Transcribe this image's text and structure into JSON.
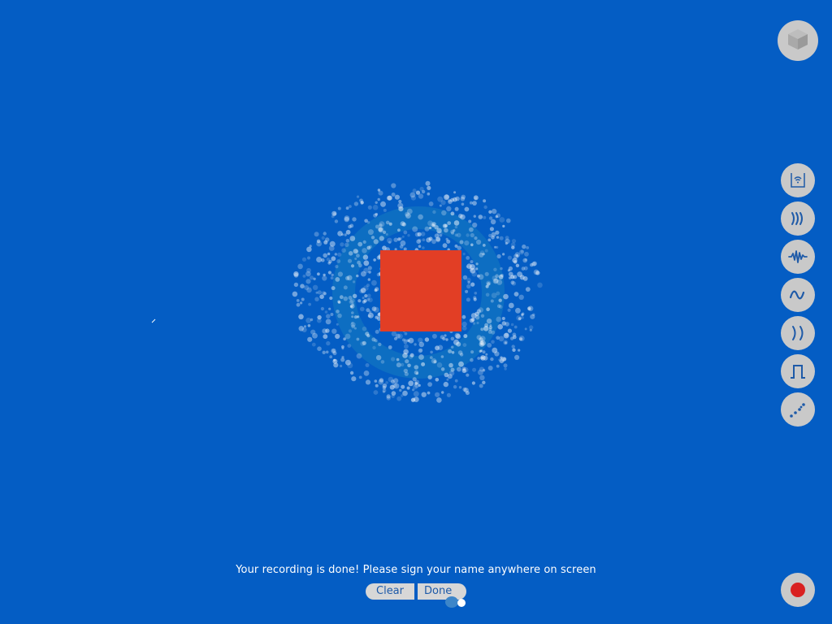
{
  "prompt": {
    "text": "Your recording is done! Please sign your name anywhere on screen"
  },
  "buttons": {
    "clear_label": "Clear",
    "done_label": "Done"
  },
  "toolbar": {
    "top_icon": "cube-icon",
    "tools": [
      {
        "icon": "wifi-box-icon"
      },
      {
        "icon": "sound-waves-icon"
      },
      {
        "icon": "waveform-icon"
      },
      {
        "icon": "sine-wave-icon"
      },
      {
        "icon": "parentheses-icon"
      },
      {
        "icon": "square-wave-icon"
      },
      {
        "icon": "dotted-diagonal-icon"
      }
    ],
    "record_icon": "record-icon"
  },
  "colors": {
    "background": "#045dc4",
    "square": "#e23e25",
    "button_bg": "#c9c9c9",
    "icon": "#1e5aa8",
    "record": "#d92020"
  }
}
